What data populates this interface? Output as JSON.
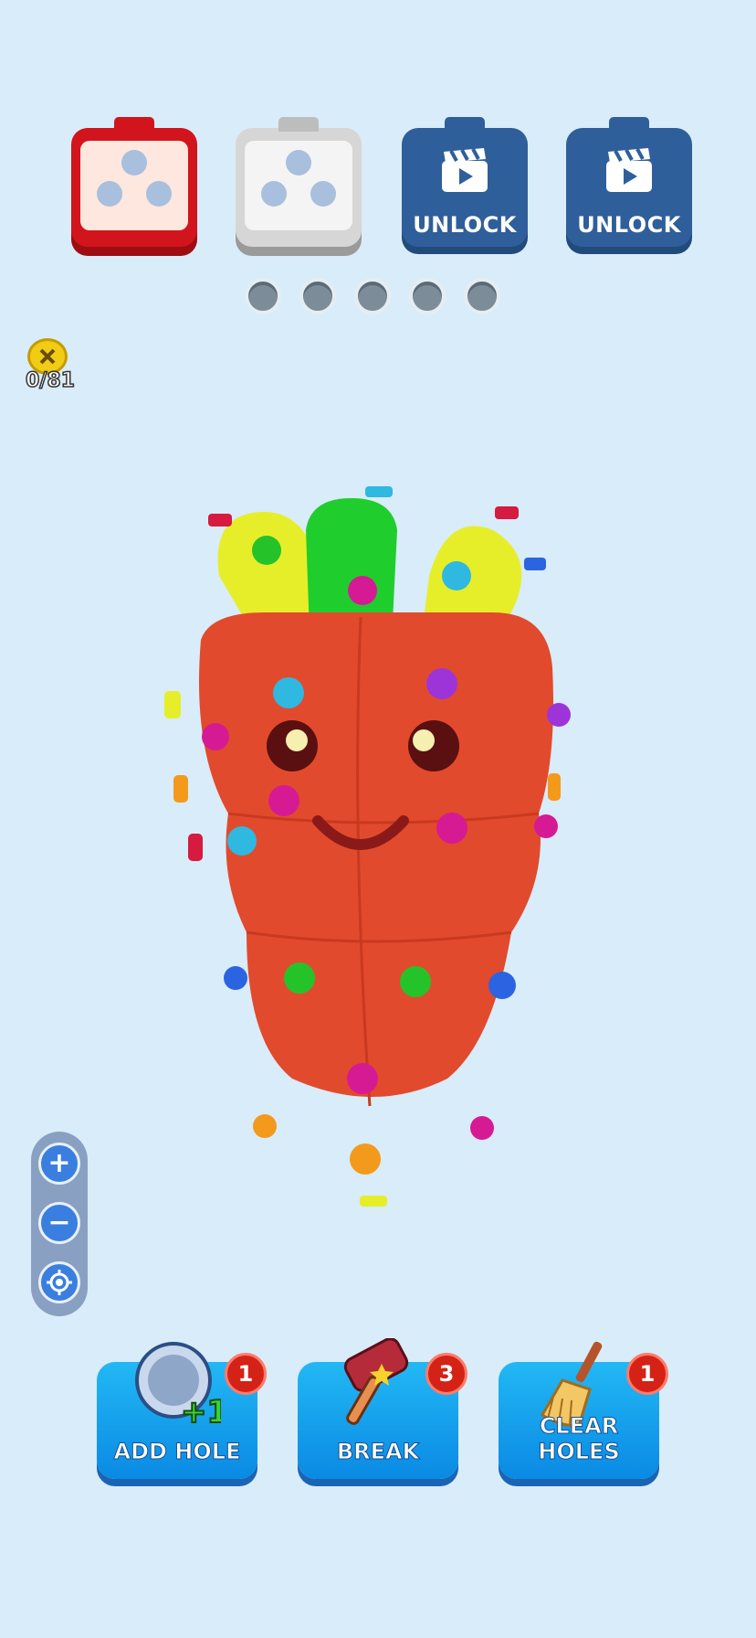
{
  "boxes": [
    {
      "state": "active",
      "color": "#d2141c"
    },
    {
      "state": "idle",
      "color": "#d6d6d6"
    },
    {
      "state": "locked",
      "label": "UNLOCK",
      "icon": "video-clapper-icon"
    },
    {
      "state": "locked",
      "label": "UNLOCK",
      "icon": "video-clapper-icon"
    }
  ],
  "progress_dots": 5,
  "screw_counter": {
    "icon": "screw-coin-icon",
    "text": "0/81"
  },
  "zoom_controls": {
    "zoom_in": "+",
    "zoom_out": "−",
    "recenter_icon": "target-icon"
  },
  "tools": [
    {
      "label": "ADD HOLE",
      "count": "1",
      "icon": "add-hole-icon",
      "overlay": "+1"
    },
    {
      "label": "BREAK",
      "count": "3",
      "icon": "hammer-icon"
    },
    {
      "label": "CLEAR HOLES",
      "count": "1",
      "icon": "broom-icon"
    }
  ],
  "colors": {
    "background": "#d9ecf9",
    "carrot": "#e24a2d",
    "leaf_yellow": "#e6ee2a",
    "leaf_green": "#1fce2c",
    "tool_blue": "#0a8ae4",
    "badge_red": "#d52217"
  }
}
